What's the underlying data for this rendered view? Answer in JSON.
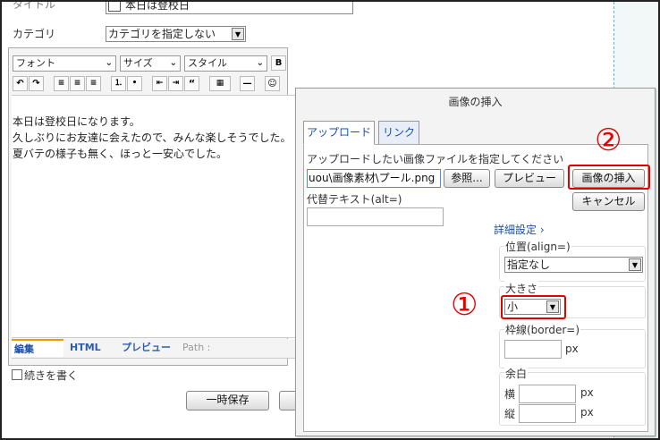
{
  "form": {
    "title_label": "タイトル",
    "title_value": "本日は登校日",
    "category_label": "カテゴリ",
    "category_value": "カテゴリを指定しない"
  },
  "toolbar": {
    "font": "フォント",
    "size": "サイズ",
    "style": "スタイル",
    "bold": "B",
    "italic": "I",
    "underline": "U",
    "strike": "S"
  },
  "content": {
    "lines": [
      "本日は登校日になります。",
      "久しぶりにお友達に会えたので、みんな楽しそうでした。",
      "夏バテの様子も無く、ほっと一安心でした。"
    ]
  },
  "editor_tabs": {
    "edit": "編集",
    "html": "HTML",
    "preview": "プレビュー",
    "path_label": "Path :"
  },
  "continue_label": "続きを書く",
  "buttons": {
    "temp_save": "一時保存"
  },
  "dialog": {
    "title": "画像の挿入",
    "tab_upload": "アップロード",
    "tab_link": "リンク",
    "upload_instruction": "アップロードしたい画像ファイルを指定してください",
    "file_value": "uou\\画像素材\\プール.png",
    "browse_btn": "参照...",
    "preview_btn": "プレビュー",
    "insert_btn": "画像の挿入",
    "cancel_btn": "キャンセル",
    "alt_label": "代替テキスト(alt=)",
    "details_link": "詳細設定",
    "align_label": "位置(align=)",
    "align_value": "指定なし",
    "size_label": "大きさ",
    "size_value": "小",
    "border_label": "枠線(border=)",
    "border_unit": "px",
    "margin_label": "余白",
    "margin_h_label": "横",
    "margin_v_label": "縦",
    "margin_h_unit": "px",
    "margin_v_unit": "px"
  },
  "annotations": {
    "one": "①",
    "two": "②"
  },
  "colors": {
    "annotation": "#e00000",
    "link": "#1a4fa0",
    "dashed_border": "#5ab4d0"
  }
}
